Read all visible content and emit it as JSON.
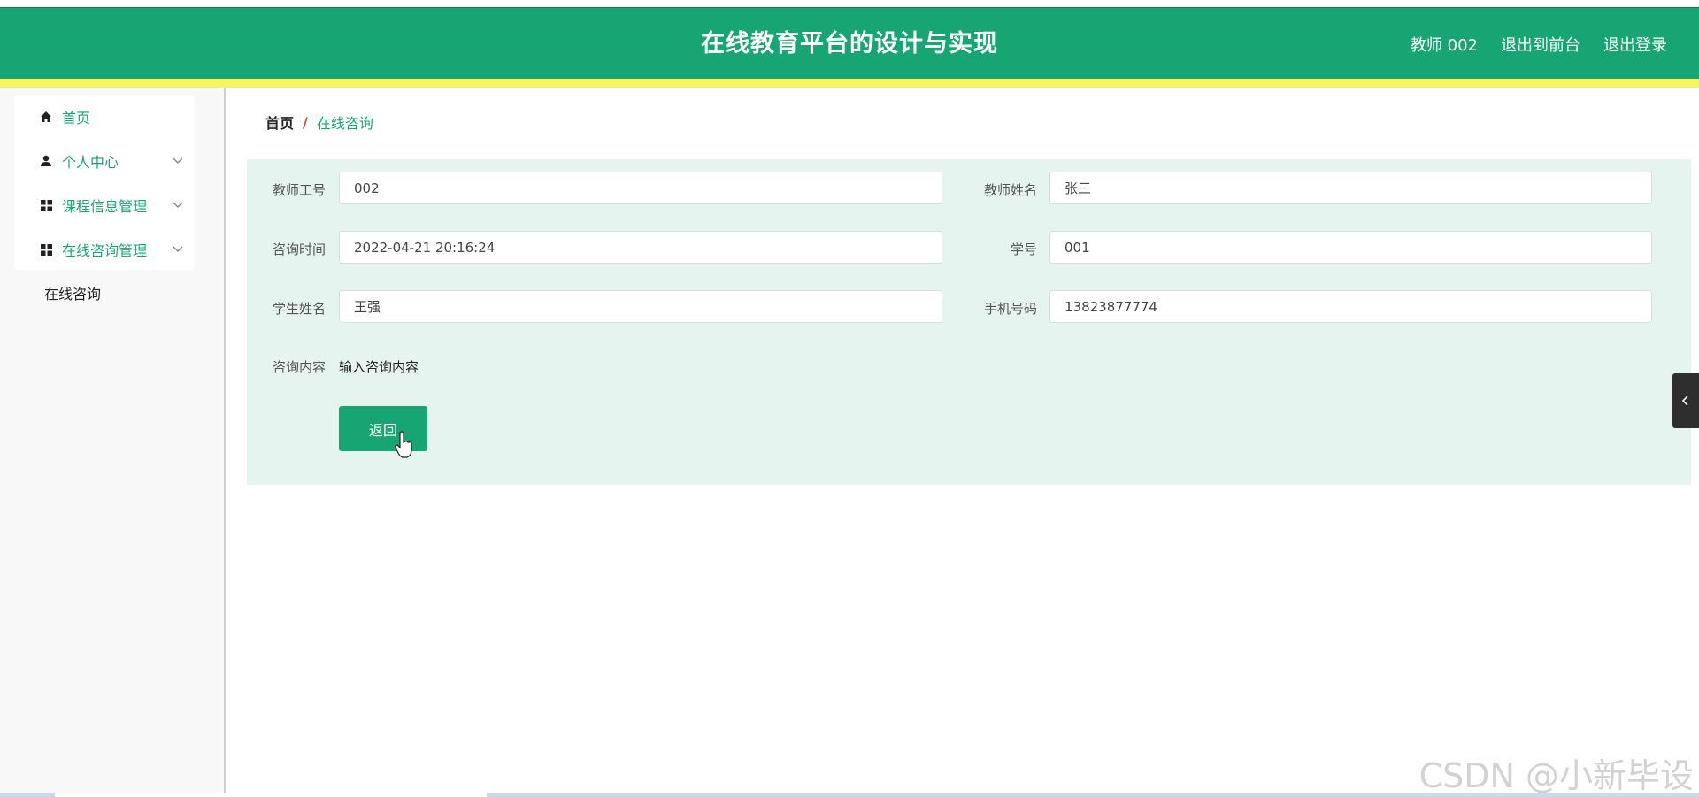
{
  "header": {
    "title": "在线教育平台的设计与实现",
    "user_label": "教师 002",
    "exit_front_label": "退出到前台",
    "logout_label": "退出登录"
  },
  "sidebar": {
    "items": [
      {
        "label": "首页",
        "icon": "home-icon"
      },
      {
        "label": "个人中心",
        "icon": "user-icon"
      },
      {
        "label": "课程信息管理",
        "icon": "grid-icon"
      },
      {
        "label": "在线咨询管理",
        "icon": "grid-icon"
      }
    ],
    "sub_item": "在线咨询"
  },
  "breadcrumb": {
    "home": "首页",
    "separator": "/",
    "current": "在线咨询"
  },
  "form": {
    "teacher_id_label": "教师工号",
    "teacher_id_value": "002",
    "teacher_name_label": "教师姓名",
    "teacher_name_value": "张三",
    "consult_time_label": "咨询时间",
    "consult_time_value": "2022-04-21 20:16:24",
    "student_id_label": "学号",
    "student_id_value": "001",
    "student_name_label": "学生姓名",
    "student_name_value": "王强",
    "phone_label": "手机号码",
    "phone_value": "13823877774",
    "content_label": "咨询内容",
    "content_value": "输入咨询内容",
    "back_label": "返回"
  },
  "watermark": "CSDN @小新毕设",
  "colors": {
    "brand": "#17a673",
    "accent_bar": "#f3f661",
    "panel_bg": "#e5f4ef",
    "breadcrumb_sep": "#d0452b"
  }
}
